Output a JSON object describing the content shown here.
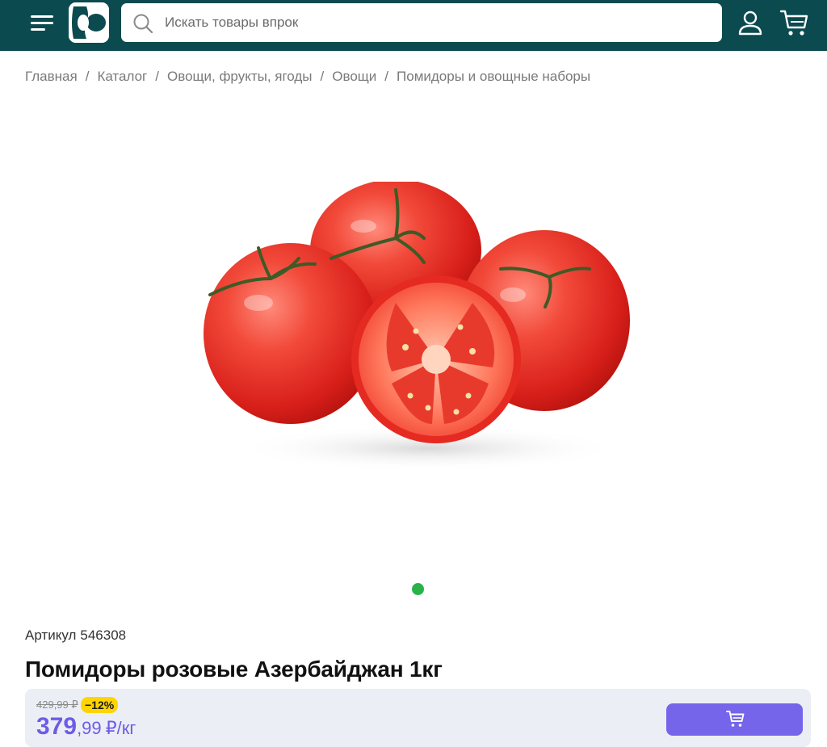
{
  "header": {
    "search": {
      "placeholder": "Искать товары впрок",
      "value": ""
    },
    "icons": [
      "menu-icon",
      "logo",
      "search-icon",
      "user-icon",
      "cart-icon"
    ],
    "background_color": "#0b4a4f"
  },
  "breadcrumb": {
    "items": [
      "Главная",
      "Каталог",
      "Овощи, фрукты, ягоды",
      "Овощи",
      "Помидоры и овощные наборы"
    ],
    "separator": "/"
  },
  "product": {
    "image": "tomatoes-photo",
    "carousel": {
      "slides": 1,
      "active": 1,
      "dot_color": "#27b34a"
    },
    "sku_label": "Артикул",
    "sku_value": "546308",
    "title": "Помидоры розовые Азербайджан 1кг",
    "price": {
      "old": "429,99 ₽",
      "discount": "−12%",
      "current_int": "379",
      "current_frac": ",99",
      "unit": "₽/кг",
      "accent_color": "#6e5ce6",
      "discount_color": "#ffd400"
    },
    "add_to_cart_icon": "cart-icon",
    "button_color": "#7565ea"
  }
}
